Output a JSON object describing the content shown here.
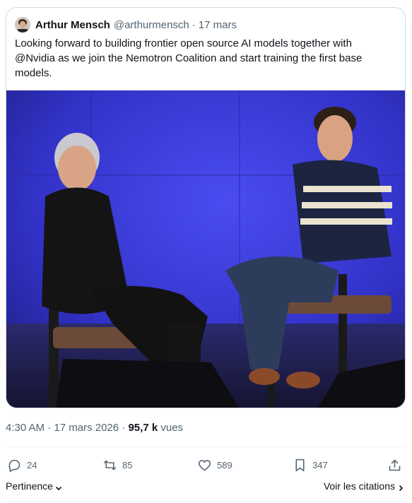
{
  "post": {
    "author_name": "Arthur Mensch",
    "author_handle": "@arthurmensch",
    "separator": "·",
    "date": "17 mars",
    "text": "Looking forward to building frontier open source AI models together with @Nvidia as we join the Nemotron Coalition and start training the first base models."
  },
  "meta": {
    "time": "4:30 AM",
    "separator_1": " · ",
    "full_date": "17 mars 2026",
    "separator_2": " · ",
    "views_count": "95,7 k",
    "views_label": " vues"
  },
  "actions": {
    "replies": "24",
    "reposts": "85",
    "likes": "589",
    "bookmarks": "347"
  },
  "footer": {
    "sort_label": "Pertinence",
    "quotes_label": "Voir les citations"
  },
  "colors": {
    "text": "#0f1419",
    "secondary": "#536471",
    "border": "#cfd9de",
    "backdrop": "#3a3bd6"
  },
  "icons": [
    "reply-icon",
    "repost-icon",
    "like-icon",
    "bookmark-icon",
    "share-icon",
    "chevron-down-icon",
    "chevron-right-icon"
  ]
}
